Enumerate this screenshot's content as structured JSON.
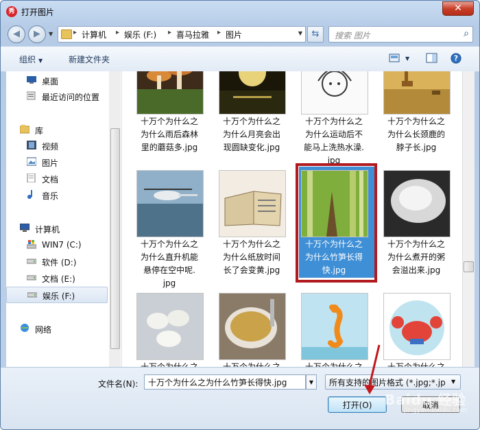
{
  "window": {
    "title": "打开图片",
    "app_icon": "秀"
  },
  "address": {
    "crumbs": [
      "计算机",
      "娱乐 (F:)",
      "喜马拉雅",
      "图片"
    ],
    "search_placeholder": "搜索 图片"
  },
  "toolbar": {
    "organize": "组织",
    "new_folder": "新建文件夹"
  },
  "sidebar": {
    "items": [
      {
        "label": "桌面",
        "icon": "desktop-icon"
      },
      {
        "label": "最近访问的位置",
        "icon": "recent-places-icon"
      },
      {
        "label": "库",
        "icon": "library-icon"
      },
      {
        "label": "视频",
        "icon": "video-icon"
      },
      {
        "label": "图片",
        "icon": "pictures-icon"
      },
      {
        "label": "文档",
        "icon": "documents-icon"
      },
      {
        "label": "音乐",
        "icon": "music-icon"
      },
      {
        "label": "计算机",
        "icon": "computer-icon"
      },
      {
        "label": "WIN7 (C:)",
        "icon": "drive-icon"
      },
      {
        "label": "软件 (D:)",
        "icon": "drive-icon"
      },
      {
        "label": "文档 (E:)",
        "icon": "drive-icon"
      },
      {
        "label": "娱乐 (F:)",
        "icon": "drive-icon",
        "selected": true
      },
      {
        "label": "网络",
        "icon": "network-icon"
      }
    ]
  },
  "files": {
    "row1": [
      {
        "lines": [
          "十万个为什么之",
          "为什么雨后森林",
          "里的蘑菇多.jpg"
        ],
        "thumb": "mushrooms"
      },
      {
        "lines": [
          "十万个为什么之",
          "为什么月亮会出",
          "现圆缺变化.jpg"
        ],
        "thumb": "moon"
      },
      {
        "lines": [
          "十万个为什么之",
          "为什么运动后不",
          "能马上洗热水澡.",
          "jpg"
        ],
        "thumb": "girl-sketch"
      },
      {
        "lines": [
          "十万个为什么之",
          "为什么长颈鹿的",
          "脖子长.jpg"
        ],
        "thumb": "giraffe"
      }
    ],
    "row2": [
      {
        "lines": [
          "十万个为什么之",
          "为什么直升机能",
          "悬停在空中呢.",
          "jpg"
        ],
        "thumb": "helicopter"
      },
      {
        "lines": [
          "十万个为什么之",
          "为什么纸放时间",
          "长了会变黄.jpg"
        ],
        "thumb": "old-book"
      },
      {
        "lines": [
          "十万个为什么之",
          "为什么竹笋长得",
          "快.jpg"
        ],
        "thumb": "bamboo",
        "selected": true
      },
      {
        "lines": [
          "十万个为什么之",
          "为什么煮开的粥",
          "会溢出来.jpg"
        ],
        "thumb": "porridge"
      }
    ],
    "row3": [
      {
        "lines": [
          "十万个为什么之"
        ],
        "thumb": "dumplings"
      },
      {
        "lines": [
          "十万个为什么之"
        ],
        "thumb": "soup"
      },
      {
        "lines": [
          "十万个为什么之"
        ],
        "thumb": "seahorse"
      },
      {
        "lines": [
          "十万个为什么之"
        ],
        "thumb": "crab"
      }
    ]
  },
  "bottom": {
    "filename_label": "文件名(N):",
    "filename_value": "十万个为什么之为什么竹笋长得快.jpg",
    "filter_value": "所有支持的图片格式 (*.jpg;*.jp",
    "open_label": "打开(O)",
    "cancel_label": "取消"
  },
  "watermark": {
    "text": "Baidu 经验",
    "sub": "jingyan.baidu.com"
  },
  "colors": {
    "selection": "#3f8fd6",
    "highlight_frame": "#b11a1f",
    "annotation_arrow": "#c0171c"
  }
}
